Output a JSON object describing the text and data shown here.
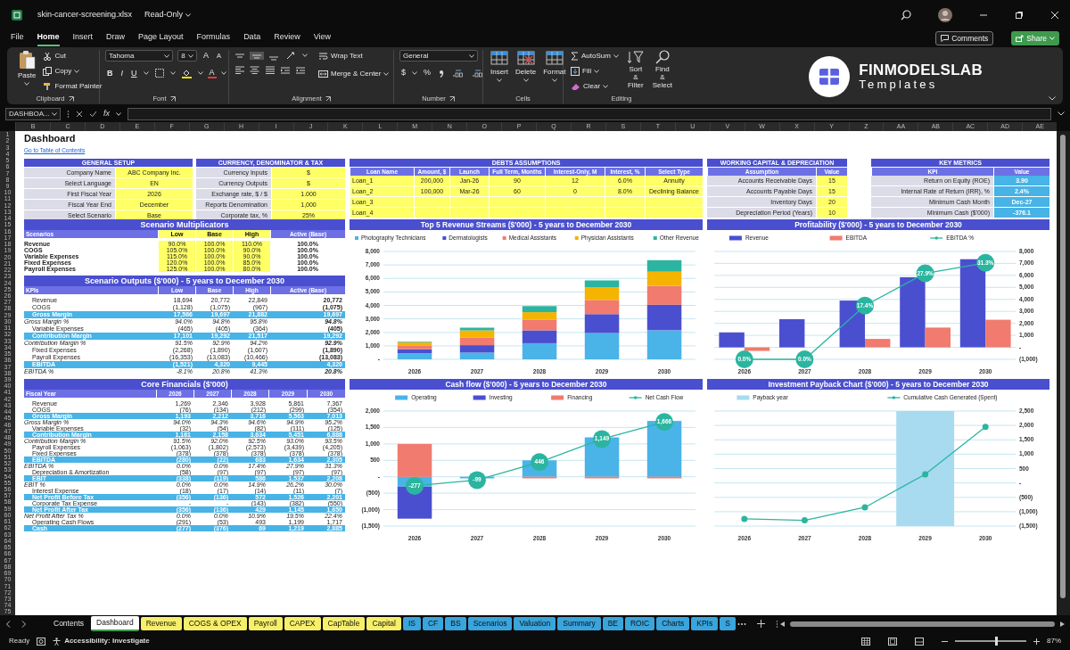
{
  "window": {
    "title": "skin-cancer-screening.xlsx",
    "mode": "Read-Only"
  },
  "menu": [
    {
      "label": "File",
      "selected": false
    },
    {
      "label": "Home",
      "selected": true
    },
    {
      "label": "Insert",
      "selected": false
    },
    {
      "label": "Draw",
      "selected": false
    },
    {
      "label": "Page Layout",
      "selected": false
    },
    {
      "label": "Formulas",
      "selected": false
    },
    {
      "label": "Data",
      "selected": false
    },
    {
      "label": "Review",
      "selected": false
    },
    {
      "label": "View",
      "selected": false
    }
  ],
  "comments_button": "Comments",
  "share_button": "Share",
  "ribbon": {
    "clipboard": {
      "label": "Clipboard",
      "paste": "Paste",
      "cut": "Cut",
      "copy": "Copy",
      "format_painter": "Format Painter"
    },
    "font": {
      "label": "Font",
      "face": "Tahoma",
      "size": "8",
      "grow": "A",
      "shrink": "A",
      "bold": "B",
      "italic": "I",
      "underline": "U",
      "paint": "A"
    },
    "alignment": {
      "label": "Alignment",
      "wrap": "Wrap Text",
      "merge": "Merge & Center"
    },
    "number": {
      "label": "Number",
      "format": "General",
      "currency": "$",
      "percent": "%"
    },
    "cells": {
      "label": "Cells",
      "insert": "Insert",
      "delete": "Delete",
      "format": "Format"
    },
    "editing": {
      "label": "Editing",
      "autosum": "AutoSum",
      "fill": "Fill",
      "clear": "Clear",
      "sort": "Sort & Filter",
      "find": "Find & Select"
    }
  },
  "logo": {
    "name": "FINMODELSLAB",
    "subtitle": "Templates"
  },
  "formula_bar": {
    "name_box": "DASHBOA...",
    "fx": "fx"
  },
  "columns": [
    "B",
    "C",
    "D",
    "E",
    "F",
    "G",
    "H",
    "I",
    "J",
    "K",
    "L",
    "M",
    "N",
    "O",
    "P",
    "Q",
    "R",
    "S",
    "T",
    "U",
    "V",
    "W",
    "X",
    "Y",
    "Z",
    "AA",
    "AB",
    "AC",
    "AD",
    "AE"
  ],
  "row_numbers": [
    "1",
    "2",
    "3",
    "4",
    "5",
    "6",
    "7",
    "8",
    "9",
    "10",
    "11",
    "12",
    "13",
    "14",
    "15",
    "16",
    "17",
    "18",
    "19",
    "20",
    "21",
    "22",
    "23",
    "24",
    "25",
    "26",
    "27",
    "28",
    "29",
    "30",
    "31",
    "32",
    "33",
    "34",
    "35",
    "36",
    "37",
    "38",
    "39",
    "40",
    "41",
    "42",
    "43",
    "44",
    "45",
    "46",
    "47",
    "48",
    "49",
    "50",
    "51",
    "52",
    "53",
    "54",
    "55",
    "56",
    "57",
    "58",
    "59",
    "60",
    "61",
    "62",
    "63",
    "64",
    "65",
    "66",
    "67",
    "68",
    "69",
    "70",
    "71",
    "72",
    "73",
    "74",
    "75"
  ],
  "sheet": {
    "title": "Dashboard",
    "link": "Go to Table of Contents",
    "general_setup": {
      "title": "GENERAL SETUP",
      "rows": [
        {
          "label": "Company Name",
          "value": "ABC Company Inc."
        },
        {
          "label": "Select Language",
          "value": "EN"
        },
        {
          "label": "First Fiscal Year",
          "value": "2026"
        },
        {
          "label": "Fiscal Year End",
          "value": "December"
        },
        {
          "label": "Select Scenario",
          "value": "Base"
        }
      ]
    },
    "currency": {
      "title": "CURRENCY, DENOMINATOR & TAX",
      "rows": [
        {
          "label": "Currency Inputs",
          "value": "$"
        },
        {
          "label": "Currency Outputs",
          "value": "$"
        },
        {
          "label": "Exchange rate, $ / $",
          "value": "1.000"
        },
        {
          "label": "Reports Denomination",
          "value": "1,000"
        },
        {
          "label": "Corporate tax, %",
          "value": "25%"
        }
      ]
    },
    "debts": {
      "title": "DEBTS ASSUMPTIONS",
      "columns": [
        "Loan Name",
        "Amount, $",
        "Launch",
        "Full Term, Months",
        "Interest-Only, M",
        "Interest, %",
        "Select Type"
      ],
      "rows": [
        [
          "Loan_1",
          "200,000",
          "Jan-26",
          "90",
          "12",
          "6.0%",
          "Annuity"
        ],
        [
          "Loan_2",
          "100,000",
          "Mar-26",
          "60",
          "0",
          "8.0%",
          "Declining Balance"
        ],
        [
          "Loan_3"
        ],
        [
          "Loan_4"
        ]
      ]
    },
    "working_capital": {
      "title": "WORKING CAPITAL & DEPRECIATION",
      "columns": [
        "Assumption",
        "Value"
      ],
      "rows": [
        [
          "Accounts Receivable Days",
          "15"
        ],
        [
          "Accounts Payable Days",
          "15"
        ],
        [
          "Inventory Days",
          "20"
        ],
        [
          "Depreciation Period (Years)",
          "10"
        ]
      ]
    },
    "key_metrics": {
      "title": "KEY METRICS",
      "columns": [
        "KPI",
        "Value"
      ],
      "rows": [
        [
          "Return on Equity (ROE)",
          "3.90"
        ],
        [
          "Internal Rate of Return (IRR), %",
          "2.4%"
        ],
        [
          "Minimum Cash Month",
          "Dec-27"
        ],
        [
          "Minimum Cash ($'000)",
          "-376.1"
        ]
      ]
    },
    "scenario_multiplicators": {
      "title": "Scenario Multiplicators",
      "columns": [
        "Scenarios",
        "Low",
        "Base",
        "High",
        "Active (Base)"
      ],
      "rows": [
        [
          "Revenue",
          "90.0%",
          "100.0%",
          "110.0%",
          "100.0%"
        ],
        [
          "COGS",
          "105.0%",
          "100.0%",
          "90.0%",
          "100.0%"
        ],
        [
          "Variable Expenses",
          "115.0%",
          "100.0%",
          "90.0%",
          "100.0%"
        ],
        [
          "Fixed Expenses",
          "120.0%",
          "100.0%",
          "85.0%",
          "100.0%"
        ],
        [
          "Payroll Expenses",
          "125.0%",
          "100.0%",
          "80.0%",
          "100.0%"
        ]
      ]
    },
    "scenario_outputs": {
      "title": "Scenario Outputs ($'000) - 5 years to December 2030",
      "columns": [
        "KPIs",
        "Low",
        "Base",
        "High",
        "Active (Base)"
      ],
      "rows": [
        {
          "kind": "item",
          "cells": [
            "Revenue",
            "18,694",
            "20,772",
            "22,849",
            "20,772"
          ]
        },
        {
          "kind": "item",
          "cells": [
            "COGS",
            "(1,128)",
            "(1,075)",
            "(967)",
            "(1,075)"
          ]
        },
        {
          "kind": "total",
          "cells": [
            "Gross Margin",
            "17,566",
            "19,697",
            "21,882",
            "19,697"
          ]
        },
        {
          "kind": "percent",
          "cells": [
            "Gross Margin %",
            "94.0%",
            "94.8%",
            "95.8%",
            "94.8%"
          ]
        },
        {
          "kind": "item",
          "cells": [
            "Variable Expenses",
            "(465)",
            "(405)",
            "(364)",
            "(405)"
          ]
        },
        {
          "kind": "total",
          "cells": [
            "Contribution Margin",
            "17,101",
            "19,292",
            "21,517",
            "19,292"
          ]
        },
        {
          "kind": "percent",
          "cells": [
            "Contribution Margin %",
            "91.5%",
            "92.9%",
            "94.2%",
            "92.9%"
          ]
        },
        {
          "kind": "item",
          "cells": [
            "Fixed Expenses",
            "(2,268)",
            "(1,890)",
            "(1,607)",
            "(1,890)"
          ]
        },
        {
          "kind": "item",
          "cells": [
            "Payroll Expenses",
            "(16,353)",
            "(13,083)",
            "(10,466)",
            "(13,083)"
          ]
        },
        {
          "kind": "total",
          "cells": [
            "EBITDA",
            "(1,521)",
            "4,320",
            "9,445",
            "4,320"
          ]
        },
        {
          "kind": "percent",
          "cells": [
            "EBITDA %",
            "-8.1%",
            "20.8%",
            "41.3%",
            "20.8%"
          ]
        }
      ]
    },
    "core_financials": {
      "title": "Core Financials ($'000)",
      "columns": [
        "Fiscal Year",
        "2026",
        "2027",
        "2028",
        "2029",
        "2030"
      ],
      "rows": [
        {
          "kind": "item",
          "cells": [
            "Revenue",
            "1,269",
            "2,346",
            "3,928",
            "5,861",
            "7,367"
          ]
        },
        {
          "kind": "item",
          "cells": [
            "COGS",
            "(76)",
            "(134)",
            "(212)",
            "(299)",
            "(354)"
          ]
        },
        {
          "kind": "total",
          "cells": [
            "Gross Margin",
            "1,193",
            "2,212",
            "3,716",
            "5,563",
            "7,013"
          ]
        },
        {
          "kind": "percent",
          "cells": [
            "Gross Margin %",
            "94.0%",
            "94.3%",
            "94.6%",
            "94.9%",
            "95.2%"
          ]
        },
        {
          "kind": "item",
          "cells": [
            "Variable Expenses",
            "(32)",
            "(54)",
            "(82)",
            "(111)",
            "(125)"
          ]
        },
        {
          "kind": "total",
          "cells": [
            "Contribution Margin",
            "1,161",
            "2,158",
            "3,634",
            "5,451",
            "6,888"
          ]
        },
        {
          "kind": "percent",
          "cells": [
            "Contribution Margin %",
            "91.5%",
            "92.0%",
            "92.5%",
            "93.0%",
            "93.5%"
          ]
        },
        {
          "kind": "item",
          "cells": [
            "Payroll Expenses",
            "(1,063)",
            "(1,802)",
            "(2,573)",
            "(3,439)",
            "(4,205)"
          ]
        },
        {
          "kind": "item",
          "cells": [
            "Fixed Expenses",
            "(378)",
            "(378)",
            "(378)",
            "(378)",
            "(378)"
          ]
        },
        {
          "kind": "total",
          "cells": [
            "EBITDA",
            "(280)",
            "(22)",
            "683",
            "1,634",
            "2,305"
          ]
        },
        {
          "kind": "percent",
          "cells": [
            "EBITDA %",
            "0.0%",
            "0.0%",
            "17.4%",
            "27.9%",
            "31.3%"
          ]
        },
        {
          "kind": "item",
          "cells": [
            "Depreciation & Amortization",
            "(58)",
            "(97)",
            "(97)",
            "(97)",
            "(97)"
          ]
        },
        {
          "kind": "total",
          "cells": [
            "EBIT",
            "(338)",
            "(119)",
            "586",
            "1,537",
            "2,208"
          ]
        },
        {
          "kind": "percent",
          "cells": [
            "EBIT %",
            "0.0%",
            "0.0%",
            "14.9%",
            "26.2%",
            "30.0%"
          ]
        },
        {
          "kind": "item",
          "cells": [
            "Interest Expense",
            "(18)",
            "(17)",
            "(14)",
            "(11)",
            "(7)"
          ]
        },
        {
          "kind": "total",
          "cells": [
            "Net Profit Before Tax",
            "(356)",
            "(136)",
            "572",
            "1,526",
            "2,201"
          ]
        },
        {
          "kind": "item",
          "cells": [
            "Corporate Tax Expense",
            "-",
            "-",
            "(143)",
            "(382)",
            "(550)"
          ]
        },
        {
          "kind": "total",
          "cells": [
            "Net Profit After Tax",
            "(356)",
            "(136)",
            "429",
            "1,145",
            "1,650"
          ]
        },
        {
          "kind": "percent",
          "cells": [
            "Net Profit After Tax %",
            "0.0%",
            "0.0%",
            "10.9%",
            "19.5%",
            "22.4%"
          ]
        },
        {
          "kind": "item",
          "cells": [
            "Operating Cash Flows",
            "(291)",
            "(53)",
            "493",
            "1,199",
            "1,717"
          ]
        },
        {
          "kind": "total",
          "cells": [
            "Cash",
            "(277)",
            "(376)",
            "69",
            "1,219",
            "2,885"
          ]
        }
      ]
    },
    "charts": [
      {
        "chart_data": {
          "type": "bar",
          "title": "Top 5 Revenue Streams ($'000) - 5 years to December 2030",
          "stacked": true,
          "grid": true,
          "legend": "top",
          "categories": [
            "2026",
            "2027",
            "2028",
            "2029",
            "2030"
          ],
          "ylim": [
            0,
            8000
          ],
          "yticks": [
            {
              "value": 0,
              "label": "-"
            },
            {
              "value": 1000,
              "label": "1,000"
            },
            {
              "value": 2000,
              "label": "2,000"
            },
            {
              "value": 3000,
              "label": "3,000"
            },
            {
              "value": 4000,
              "label": "4,000"
            },
            {
              "value": 5000,
              "label": "5,000"
            },
            {
              "value": 6000,
              "label": "6,000"
            },
            {
              "value": 7000,
              "label": "7,000"
            },
            {
              "value": 8000,
              "label": "8,000"
            }
          ],
          "series": [
            {
              "name": "Photography Technicians",
              "color": "#4ab3e8",
              "values": [
                450,
                500,
                1200,
                1950,
                2150
              ]
            },
            {
              "name": "Dermatologists",
              "color": "#4a4fd0",
              "values": [
                300,
                550,
                950,
                1400,
                1900
              ]
            },
            {
              "name": "Medical Assistants",
              "color": "#f07b6e",
              "values": [
                250,
                550,
                800,
                1050,
                1400
              ]
            },
            {
              "name": "Physician Assistants",
              "color": "#f5b400",
              "values": [
                250,
                550,
                550,
                950,
                1050
              ]
            },
            {
              "name": "Other Revenue",
              "color": "#2bb5a0",
              "values": [
                50,
                200,
                450,
                500,
                850
              ]
            }
          ]
        }
      },
      {
        "chart_data": {
          "type": "bar",
          "title": "Profitability ($'000) - 5 years to December 2030",
          "stacked": false,
          "grid": true,
          "legend": "top",
          "categories": [
            "2026",
            "2027",
            "2028",
            "2029",
            "2030"
          ],
          "ylim": [
            -1000,
            8000
          ],
          "y2lim": [
            0,
            35
          ],
          "yticks": [
            {
              "value": -1000,
              "label": "(1,000)"
            },
            {
              "value": 0,
              "label": "-"
            },
            {
              "value": 1000,
              "label": "1,000"
            },
            {
              "value": 2000,
              "label": "2,000"
            },
            {
              "value": 3000,
              "label": "3,000"
            },
            {
              "value": 4000,
              "label": "4,000"
            },
            {
              "value": 5000,
              "label": "5,000"
            },
            {
              "value": 6000,
              "label": "6,000"
            },
            {
              "value": 7000,
              "label": "7,000"
            },
            {
              "value": 8000,
              "label": "8,000"
            }
          ],
          "series": [
            {
              "name": "Revenue",
              "color": "#4a4fd0",
              "values": [
                1250,
                2350,
                3900,
                5850,
                7350
              ]
            },
            {
              "name": "EBITDA",
              "color": "#f07b6e",
              "values": [
                -300,
                null,
                700,
                1650,
                2300
              ]
            },
            {
              "name": "EBITDA %",
              "type": "line",
              "axis": "y2",
              "marker": "o",
              "color": "#2bb5a0",
              "values": [
                0,
                0,
                17.4,
                27.9,
                31.3
              ],
              "value_labels": [
                "0.0%",
                "0.0%",
                "17.4%",
                "27.9%",
                "31.3%"
              ]
            }
          ]
        }
      },
      {
        "chart_data": {
          "type": "bar",
          "title": "Cash flow ($'000) - 5 years to December 2030",
          "stacked": true,
          "grid": true,
          "legend": "top",
          "categories": [
            "2026",
            "2027",
            "2028",
            "2029",
            "2030"
          ],
          "ylim": [
            -1500,
            2000
          ],
          "yticks": [
            {
              "value": -1500,
              "label": "(1,500)"
            },
            {
              "value": -1000,
              "label": "(1,000)"
            },
            {
              "value": -500,
              "label": "(500)"
            },
            {
              "value": 0,
              "label": "-"
            },
            {
              "value": 500,
              "label": "500"
            },
            {
              "value": 1000,
              "label": "1,000"
            },
            {
              "value": 1500,
              "label": "1,500"
            },
            {
              "value": 2000,
              "label": "2,000"
            }
          ],
          "series": [
            {
              "name": "Operating",
              "color": "#4ab3e8",
              "values": [
                -300,
                -50,
                500,
                1200,
                1700
              ]
            },
            {
              "name": "Investing",
              "color": "#4a4fd0",
              "values": [
                -975,
                0,
                0,
                0,
                0
              ]
            },
            {
              "name": "Financing",
              "color": "#f07b6e",
              "values": [
                1000,
                null,
                -50,
                -50,
                -50
              ]
            },
            {
              "name": "Net Cash Flow",
              "type": "line",
              "marker": "o",
              "color": "#2bb5a0",
              "values": [
                -277,
                -99,
                446,
                1149,
                1666
              ],
              "value_labels": [
                "-277",
                "-99",
                "446",
                "1,149",
                "1,666"
              ]
            }
          ]
        }
      },
      {
        "chart_data": {
          "type": "line",
          "title": "Investment Payback Chart ($'000) - 5 years to December 2030",
          "grid": true,
          "legend": "top",
          "categories": [
            "2026",
            "2027",
            "2028",
            "2029",
            "2030"
          ],
          "ylim": [
            -1500,
            2500
          ],
          "yticks": [
            {
              "value": -1500,
              "label": "(1,500)"
            },
            {
              "value": -1000,
              "label": "(1,000)"
            },
            {
              "value": -500,
              "label": "(500)"
            },
            {
              "value": 0,
              "label": "-"
            },
            {
              "value": 500,
              "label": "500"
            },
            {
              "value": 1000,
              "label": "1,000"
            },
            {
              "value": 1500,
              "label": "1,500"
            },
            {
              "value": 2000,
              "label": "2,000"
            },
            {
              "value": 2500,
              "label": "2,500"
            }
          ],
          "bands": [
            {
              "axis": "x",
              "from": "2029",
              "to": "2029",
              "label": "Payback year",
              "color": "#a8daf0"
            }
          ],
          "series": [
            {
              "name": "Cumulative Cash Generated (Spent)",
              "marker": "o",
              "color": "#2bb5a0",
              "values": [
                -1250,
                -1300,
                -850,
                300,
                1950
              ]
            }
          ]
        }
      }
    ]
  },
  "sheet_tabs": [
    {
      "label": "Contents",
      "selected": false
    },
    {
      "label": "Dashboard",
      "selected": true
    },
    {
      "label": "Revenue",
      "selected": false,
      "color": "#f7ef6a"
    },
    {
      "label": "COGS & OPEX",
      "selected": false,
      "color": "#f7ef6a"
    },
    {
      "label": "Payroll",
      "selected": false,
      "color": "#f7ef6a"
    },
    {
      "label": "CAPEX",
      "selected": false,
      "color": "#f7ef6a"
    },
    {
      "label": "CapTable",
      "selected": false,
      "color": "#f7ef6a"
    },
    {
      "label": "Capital",
      "selected": false,
      "color": "#f7ef6a"
    },
    {
      "label": "IS",
      "selected": false,
      "color": "#3aa4dc"
    },
    {
      "label": "CF",
      "selected": false,
      "color": "#3aa4dc"
    },
    {
      "label": "BS",
      "selected": false,
      "color": "#3aa4dc"
    },
    {
      "label": "Scenarios",
      "selected": false,
      "color": "#3aa4dc"
    },
    {
      "label": "Valuation",
      "selected": false,
      "color": "#3aa4dc"
    },
    {
      "label": "Summary",
      "selected": false,
      "color": "#3aa4dc"
    },
    {
      "label": "BE",
      "selected": false,
      "color": "#3aa4dc"
    },
    {
      "label": "ROIC",
      "selected": false,
      "color": "#3aa4dc"
    },
    {
      "label": "Charts",
      "selected": false,
      "color": "#3aa4dc"
    },
    {
      "label": "KPIs",
      "selected": false,
      "color": "#3aa4dc"
    },
    {
      "label": "S",
      "selected": false,
      "color": "#3aa4dc"
    }
  ],
  "status_bar": {
    "ready": "Ready",
    "accessibility": "Accessibility: Investigate",
    "zoom": {
      "level": 0.58,
      "reading": "87%"
    }
  }
}
